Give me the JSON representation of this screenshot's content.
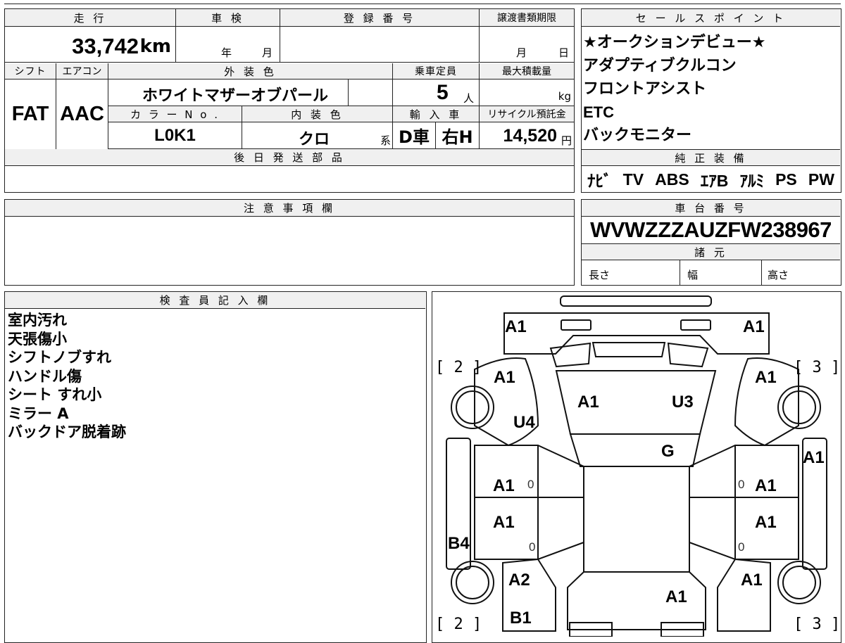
{
  "top_row": {
    "mileage_label": "走 行",
    "mileage_value": "33,742",
    "mileage_unit": "km",
    "inspection_label": "車 検",
    "year_unit": "年",
    "month_unit": "月",
    "registration_label": "登 録 番 号",
    "transfer_label": "譲渡書類期限",
    "transfer_month": "月",
    "transfer_day": "日"
  },
  "middle_row": {
    "shift_label": "シフト",
    "shift_value": "FAT",
    "ac_label": "エアコン",
    "ac_value": "AAC",
    "exterior_label": "外 装 色",
    "exterior_value": "ホワイトマザーオブパール",
    "capacity_label": "乗車定員",
    "capacity_value": "5",
    "capacity_unit": "人",
    "load_label": "最大積載量",
    "load_unit": "kg",
    "color_no_label": "カ ラ ー N o .",
    "color_no_value": "L0K1",
    "interior_label": "内 装 色",
    "interior_value": "クロ",
    "interior_unit": "系",
    "import_label": "輸 入 車",
    "import_value": "D車",
    "handle_value": "右H",
    "recycle_label": "リサイクル預託金",
    "recycle_value": "14,520",
    "recycle_unit": "円",
    "later_parts_label": "後 日 発 送 部 品"
  },
  "sales_points": {
    "label": "セ ー ル ス ポ イ ン ト",
    "lines": [
      "★オークションデビュー★",
      "アダプティブクルコン",
      "フロントアシスト",
      "ETC",
      "バックモニター"
    ]
  },
  "genuine_equipment": {
    "label": "純 正 装 備",
    "items": [
      "ﾅﾋﾞ",
      "TV",
      "ABS",
      "ｴｱB",
      "ｱﾙﾐ",
      "PS",
      "PW"
    ]
  },
  "notes": {
    "label": "注 意 事 項 欄"
  },
  "chassis": {
    "label": "車 台 番 号",
    "value": "WVWZZZAUZFW238967"
  },
  "specs": {
    "label": "諸 元",
    "length": "長さ",
    "width": "幅",
    "height": "高さ"
  },
  "inspector": {
    "label": "検 査 員 記 入 欄",
    "lines": [
      "室内汚れ",
      "天張傷小",
      "シフトノブすれ",
      "ハンドル傷",
      "シート すれ小",
      "ミラー A",
      "バックドア脱着跡"
    ]
  },
  "diagram": {
    "labels": {
      "fl_top": "A1",
      "fr_top": "A1",
      "l_fender": "A1",
      "r_fender": "A1",
      "hood_l": "A1",
      "hood_r": "U3",
      "l_u4": "U4",
      "windshield": "G",
      "r_edge": "A1",
      "l_door1": "A1",
      "r_door1": "A1",
      "l_door2": "A1",
      "r_door2": "A1",
      "l_b4": "B4",
      "l_rear": "A2",
      "r_rear": "A1",
      "roof_rear": "A1",
      "l_b1": "B1"
    },
    "zeros": [
      "0",
      "0",
      "0",
      "0"
    ],
    "brackets": {
      "fl": "[ 2 ]",
      "fr": "[ 3 ]",
      "rl": "[ 2 ]",
      "rr": "[ 3 ]"
    }
  }
}
